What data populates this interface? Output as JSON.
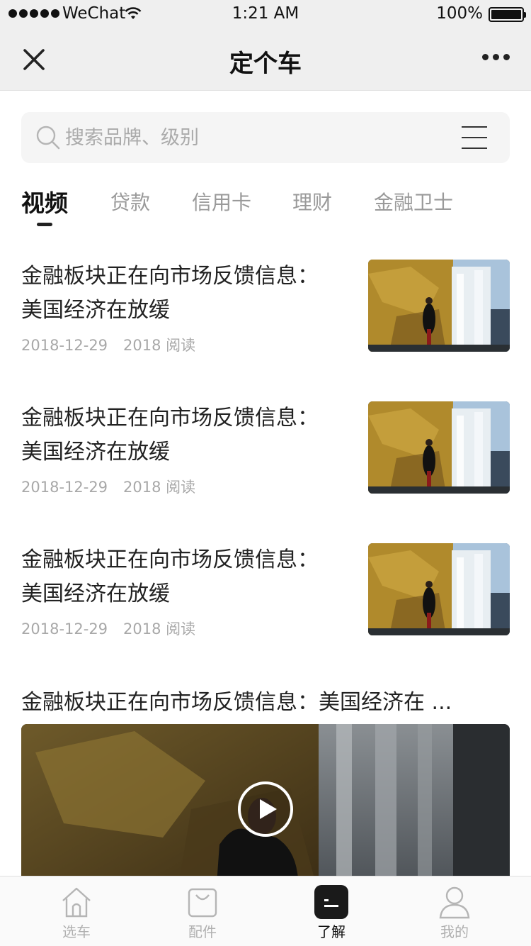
{
  "status_bar": {
    "carrier": "WeChat",
    "time": "1:21 AM",
    "battery": "100%"
  },
  "nav": {
    "title": "定个车"
  },
  "search": {
    "placeholder": "搜索品牌、级别"
  },
  "tabs": [
    {
      "label": "视频",
      "active": true
    },
    {
      "label": "贷款",
      "active": false
    },
    {
      "label": "信用卡",
      "active": false
    },
    {
      "label": "理财",
      "active": false
    },
    {
      "label": "金融卫士",
      "active": false
    }
  ],
  "articles": [
    {
      "title": "金融板块正在向市场反馈信息：美国经济在放缓",
      "date": "2018-12-29",
      "reads": "2018 阅读"
    },
    {
      "title": "金融板块正在向市场反馈信息：美国经济在放缓",
      "date": "2018-12-29",
      "reads": "2018 阅读"
    },
    {
      "title": "金融板块正在向市场反馈信息：美国经济在放缓",
      "date": "2018-12-29",
      "reads": "2018 阅读"
    }
  ],
  "video_article": {
    "title": "金融板块正在向市场反馈信息：美国经济在 ..."
  },
  "tab_bar": [
    {
      "label": "选车",
      "icon": "home-icon",
      "active": false
    },
    {
      "label": "配件",
      "icon": "shopping-bag-icon",
      "active": false
    },
    {
      "label": "了解",
      "icon": "info-icon",
      "active": true
    },
    {
      "label": "我的",
      "icon": "user-icon",
      "active": false
    }
  ]
}
